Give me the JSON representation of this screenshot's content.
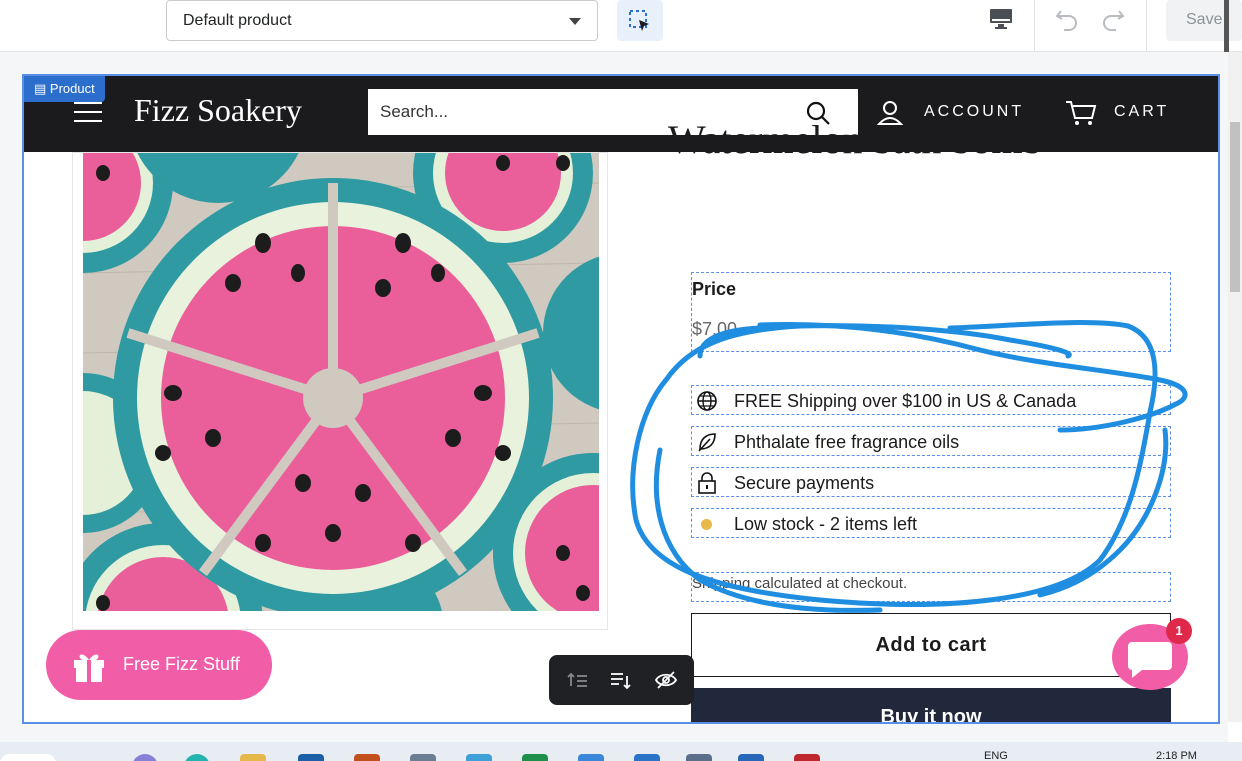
{
  "editor": {
    "template_select": "Default product",
    "save_label": "Save",
    "section_tag": "Product"
  },
  "store": {
    "brand": "Fizz Soakery",
    "search_placeholder": "Search...",
    "account_label": "ACCOUNT",
    "cart_label": "CART"
  },
  "product": {
    "title": "Watermelon bath bomb",
    "price_label": "Price",
    "price_value": "$7.00",
    "features": [
      {
        "icon": "globe-icon",
        "text": "FREE Shipping over $100 in US & Canada"
      },
      {
        "icon": "leaf-icon",
        "text": "Phthalate free fragrance oils"
      },
      {
        "icon": "lock-icon",
        "text": "Secure payments"
      },
      {
        "icon": "stock-dot-icon",
        "text": "Low stock - 2 items left"
      }
    ],
    "shipping_note": "Shipping calculated at checkout.",
    "add_to_cart": "Add to cart",
    "buy_now": "Buy it now"
  },
  "widgets": {
    "fizz_button": "Free Fizz Stuff",
    "chat_badge": "1"
  },
  "taskbar": {
    "lang": "ENG",
    "clock": "2:18 PM"
  },
  "colors": {
    "accent_blue": "#2c6ecb",
    "store_header": "#1b1b1d",
    "pink": "#f25da7",
    "annotation_blue": "#1f8de0",
    "stock_dot": "#e8b84a"
  }
}
